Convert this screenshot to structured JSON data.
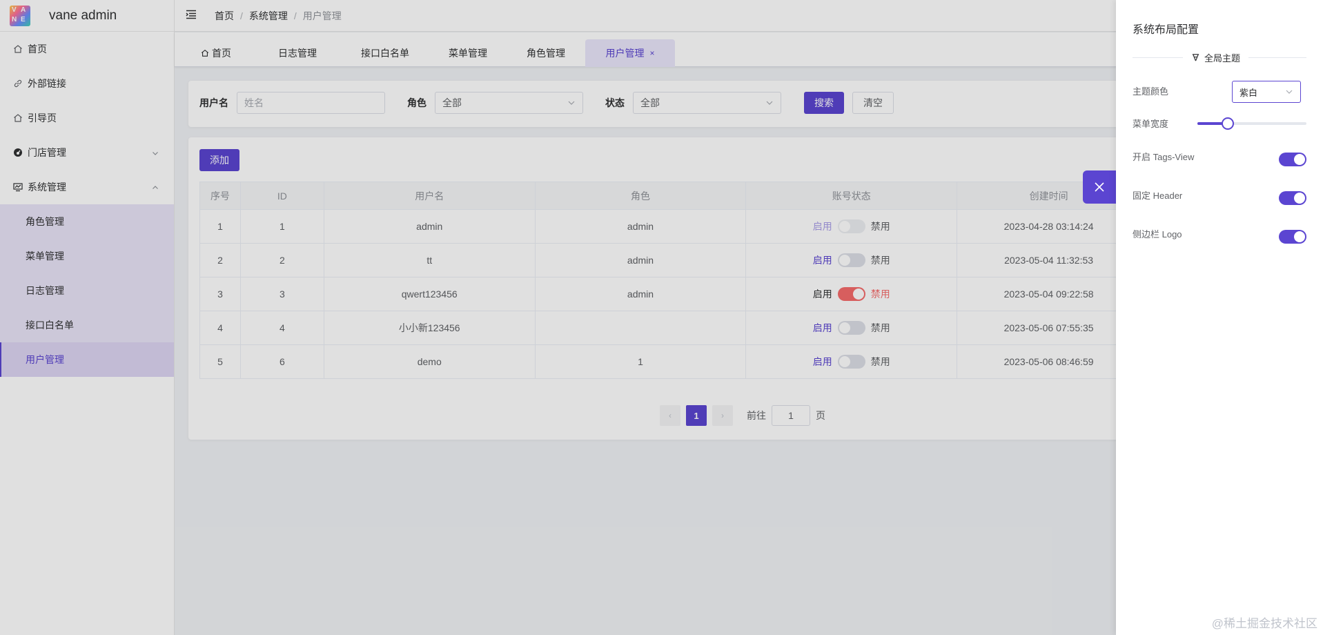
{
  "app": {
    "logo_text": "VANE",
    "title": "vane admin"
  },
  "sidebar": {
    "items": [
      {
        "label": "首页",
        "icon": "home-icon"
      },
      {
        "label": "外部链接",
        "icon": "link-icon"
      },
      {
        "label": "引导页",
        "icon": "home-icon"
      },
      {
        "label": "门店管理",
        "icon": "dashboard-icon",
        "expanded": false
      },
      {
        "label": "系统管理",
        "icon": "monitor-icon",
        "expanded": true
      }
    ],
    "sub_items": [
      {
        "label": "角色管理"
      },
      {
        "label": "菜单管理"
      },
      {
        "label": "日志管理"
      },
      {
        "label": "接口白名单"
      },
      {
        "label": "用户管理",
        "active": true
      }
    ]
  },
  "breadcrumb": [
    "首页",
    "系统管理",
    "用户管理"
  ],
  "tabs": [
    {
      "label": "首页",
      "has_icon": true
    },
    {
      "label": "日志管理"
    },
    {
      "label": "接口白名单"
    },
    {
      "label": "菜单管理"
    },
    {
      "label": "角色管理"
    },
    {
      "label": "用户管理",
      "active": true,
      "close": "×"
    }
  ],
  "search": {
    "username_label": "用户名",
    "username_placeholder": "姓名",
    "role_label": "角色",
    "role_value": "全部",
    "status_label": "状态",
    "status_value": "全部",
    "search_button": "搜索",
    "clear_button": "清空"
  },
  "table": {
    "add_button": "添加",
    "columns": [
      "序号",
      "ID",
      "用户名",
      "角色",
      "账号状态",
      "创建时间"
    ],
    "status_on_label": "启用",
    "status_off_label": "禁用",
    "rows": [
      {
        "index": "1",
        "id": "1",
        "username": "admin",
        "role": "admin",
        "disabled": false,
        "locked": true,
        "created": "2023-04-28 03:14:24"
      },
      {
        "index": "2",
        "id": "2",
        "username": "tt",
        "role": "admin",
        "disabled": false,
        "locked": false,
        "created": "2023-05-04 11:32:53"
      },
      {
        "index": "3",
        "id": "3",
        "username": "qwert123456",
        "role": "admin",
        "disabled": true,
        "locked": false,
        "created": "2023-05-04 09:22:58"
      },
      {
        "index": "4",
        "id": "4",
        "username": "小小新123456",
        "role": "",
        "disabled": false,
        "locked": false,
        "created": "2023-05-06 07:55:35"
      },
      {
        "index": "5",
        "id": "6",
        "username": "demo",
        "role": "1",
        "disabled": false,
        "locked": false,
        "created": "2023-05-06 08:46:59"
      }
    ]
  },
  "pagination": {
    "current": "1",
    "goto_label": "前往",
    "goto_value": "1",
    "page_suffix": "页",
    "prev": "‹",
    "next": "›"
  },
  "settings": {
    "title": "系统布局配置",
    "section": "全局主题",
    "theme_color_label": "主题颜色",
    "theme_color_value": "紫白",
    "menu_width_label": "菜单宽度",
    "menu_width_level": 0.28,
    "tags_view_label": "开启 Tags-View",
    "tags_view_on": true,
    "fixed_header_label": "固定 Header",
    "fixed_header_on": true,
    "sidebar_logo_label": "侧边栏 Logo",
    "sidebar_logo_on": true
  },
  "colors": {
    "accent": "#5b45d1",
    "danger": "#f56c6c"
  },
  "watermark": "@稀土掘金技术社区"
}
